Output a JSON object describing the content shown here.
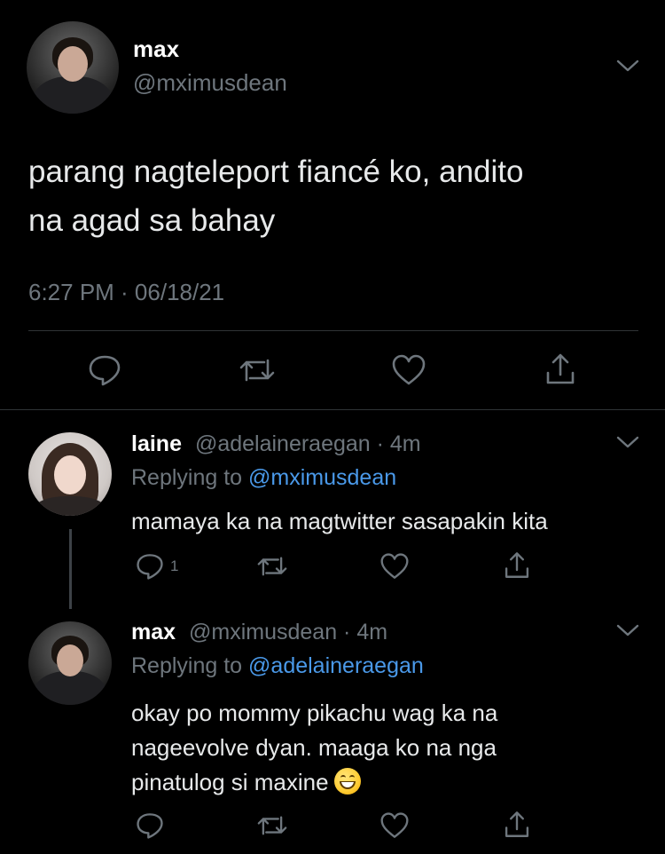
{
  "main_tweet": {
    "name": "max",
    "handle": "@mximusdean",
    "text_line1": "parang nagteleport fiancé ko, andito",
    "text_line2": "na agad sa bahay",
    "timestamp": "6:27 PM · 06/18/21"
  },
  "replies": [
    {
      "name": "laine",
      "meta": "@adelaineraegan · 4m",
      "replying_label": "Replying to",
      "replying_to": "@mximusdean",
      "text_line1": "mamaya ka na magtwitter sasapakin kita",
      "reply_count": "1"
    },
    {
      "name": "max",
      "meta": "@mximusdean · 4m",
      "replying_label": "Replying to",
      "replying_to": "@adelaineraegan",
      "text_line1": "okay po mommy pikachu wag ka na",
      "text_line2": "nageevolve dyan. maaga ko na nga",
      "text_line3": "pinatulog si maxine",
      "emoji": "grinning-face"
    }
  ],
  "icons": {
    "reply": "reply-icon",
    "retweet": "retweet-icon",
    "like": "heart-icon",
    "share": "share-icon",
    "more": "chevron-down-icon"
  },
  "colors": {
    "background": "#000000",
    "text": "#e7e9ea",
    "muted": "#6e767d",
    "link": "#4a99e9",
    "divider": "#2f3336"
  }
}
